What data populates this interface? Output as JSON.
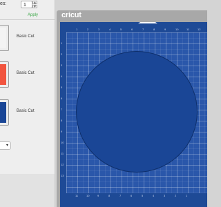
{
  "copies": {
    "label": "es:",
    "value": "1",
    "apply_label": "Apply"
  },
  "mats": [
    {
      "label": "Basic Cut",
      "swatch_color": "#f4f4f4"
    },
    {
      "label": "Basic Cut",
      "swatch_color": "#f2553f"
    },
    {
      "label": "Basic Cut",
      "swatch_color": "#1a4696"
    }
  ],
  "select": {
    "caret": "▾"
  },
  "mat": {
    "brand": "cricut",
    "top_ticks": [
      "1",
      "2",
      "3",
      "4",
      "5",
      "6",
      "7",
      "8",
      "9",
      "10",
      "11",
      "12"
    ],
    "left_ticks": [
      "1",
      "2",
      "3",
      "4",
      "5",
      "6",
      "7",
      "8",
      "9",
      "10",
      "11",
      "12",
      "13"
    ],
    "bottom_ticks": [
      "11",
      "10",
      "9",
      "8",
      "7",
      "6",
      "5",
      "4",
      "3",
      "2",
      "1"
    ],
    "shape": {
      "type": "circle",
      "fill": "#1a4696"
    }
  },
  "colors": {
    "accent": "#3ea84a",
    "mat_blue": "#2a57aa",
    "ruler_blue": "#1e4a96",
    "frame_gray": "#a8a8a8"
  }
}
